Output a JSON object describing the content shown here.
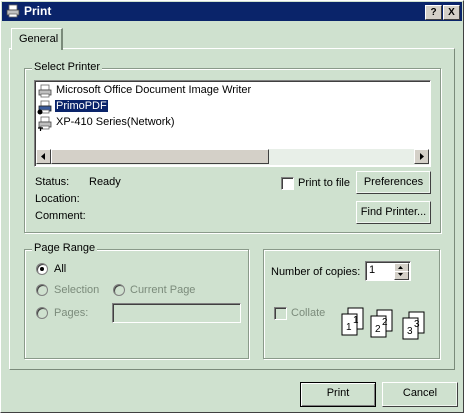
{
  "window": {
    "title": "Print"
  },
  "titlebar": {
    "help_label": "?",
    "close_label": "X"
  },
  "tabs": [
    {
      "label": "General"
    }
  ],
  "select_printer": {
    "label": "Select Printer",
    "printers": [
      {
        "name": "Microsoft Office Document Image Writer",
        "selected": false
      },
      {
        "name": "PrimoPDF",
        "selected": true
      },
      {
        "name": "XP-410 Series(Network)",
        "selected": false
      }
    ],
    "status_label": "Status:",
    "status_value": "Ready",
    "location_label": "Location:",
    "location_value": "",
    "comment_label": "Comment:",
    "comment_value": "",
    "print_to_file_label": "Print to file",
    "print_to_file_checked": false,
    "preferences_label": "Preferences",
    "find_printer_label": "Find Printer..."
  },
  "page_range": {
    "label": "Page Range",
    "all_label": "All",
    "selection_label": "Selection",
    "current_page_label": "Current Page",
    "pages_label": "Pages:",
    "pages_value": "",
    "selected_option": "All"
  },
  "copies": {
    "label": "Number of copies:",
    "value": "1",
    "collate_label": "Collate",
    "collate_checked": false,
    "collate_icon_pages": [
      "1",
      "1",
      "2",
      "2",
      "3",
      "3"
    ]
  },
  "footer": {
    "print_label": "Print",
    "cancel_label": "Cancel"
  },
  "colors": {
    "titlebar": "#0a246a",
    "face": "#cfe1cf",
    "selection": "#0a246a"
  }
}
